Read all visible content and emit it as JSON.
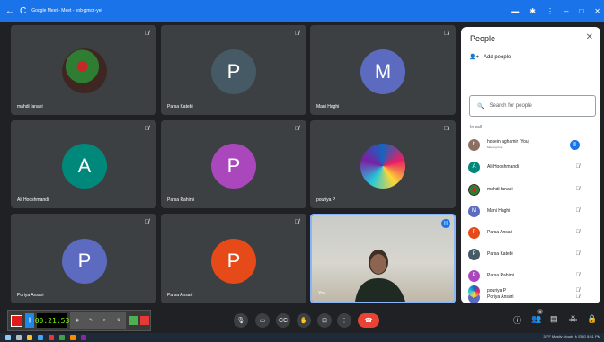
{
  "titlebar": {
    "back": "←",
    "reload": "C",
    "title": "Google Meet - Meet - snb-gmcz-yei",
    "right_icons": [
      "camera-icon",
      "extension-icon",
      "more-vert-icon"
    ],
    "window_controls": [
      "–",
      "□",
      "✕"
    ]
  },
  "tiles": [
    {
      "name": "mahdi fanaei",
      "type": "photo",
      "photo_colors": [
        "#2f5d3a",
        "#6b3b2e"
      ]
    },
    {
      "name": "Parsa Katebi",
      "type": "letter",
      "letter": "P",
      "color": "#455a64"
    },
    {
      "name": "Mani Haghi",
      "type": "letter",
      "letter": "M",
      "color": "#5c6bc0"
    },
    {
      "name": "Ali Hooshmandi",
      "type": "letter",
      "letter": "A",
      "color": "#00897b"
    },
    {
      "name": "Parsa Rahimi",
      "type": "letter",
      "letter": "P",
      "color": "#ab47bc"
    },
    {
      "name": "pouriya P",
      "type": "photo",
      "photo_colors": [
        "#1e88e5",
        "#e91e63"
      ]
    },
    {
      "name": "Poriya Ansari",
      "type": "letter",
      "letter": "P",
      "color": "#5c6bc0"
    },
    {
      "name": "Parsa Ansari",
      "type": "letter",
      "letter": "P",
      "color": "#e64a19"
    },
    {
      "name": "You",
      "type": "video"
    }
  ],
  "people_panel": {
    "title": "People",
    "add_people": "Add people",
    "search_placeholder": "Search for people",
    "section_label": "In call",
    "participants": [
      {
        "name": "hosein aghamir (You)",
        "sub": "Meeting host",
        "letter": "h",
        "color": "#8d6e63",
        "mic": "active"
      },
      {
        "name": "Ali Hooshmandi",
        "sub": "",
        "letter": "A",
        "color": "#00897b",
        "mic": "muted"
      },
      {
        "name": "mahdi fanaei",
        "sub": "",
        "letter": "",
        "color": "#4e342e",
        "mic": "muted"
      },
      {
        "name": "Mani Haghi",
        "sub": "",
        "letter": "M",
        "color": "#5c6bc0",
        "mic": "muted"
      },
      {
        "name": "Parsa Ansari",
        "sub": "",
        "letter": "P",
        "color": "#e64a19",
        "mic": "muted"
      },
      {
        "name": "Parsa Katebi",
        "sub": "",
        "letter": "P",
        "color": "#455a64",
        "mic": "muted"
      },
      {
        "name": "Parsa Rahimi",
        "sub": "",
        "letter": "P",
        "color": "#ab47bc",
        "mic": "muted"
      },
      {
        "name": "Poriya Ansari",
        "sub": "",
        "letter": "P",
        "color": "#5c6bc0",
        "mic": "muted"
      },
      {
        "name": "pouriya P",
        "sub": "",
        "letter": "",
        "color": "#1e88e5",
        "mic": "muted"
      }
    ]
  },
  "controls": {
    "participant_count": "9"
  },
  "recorder": {
    "timer": "00:21:53"
  },
  "taskbar": {
    "tray_text": "32°F  Mostly cloudy   ∧  ENG  8:51 PM"
  }
}
